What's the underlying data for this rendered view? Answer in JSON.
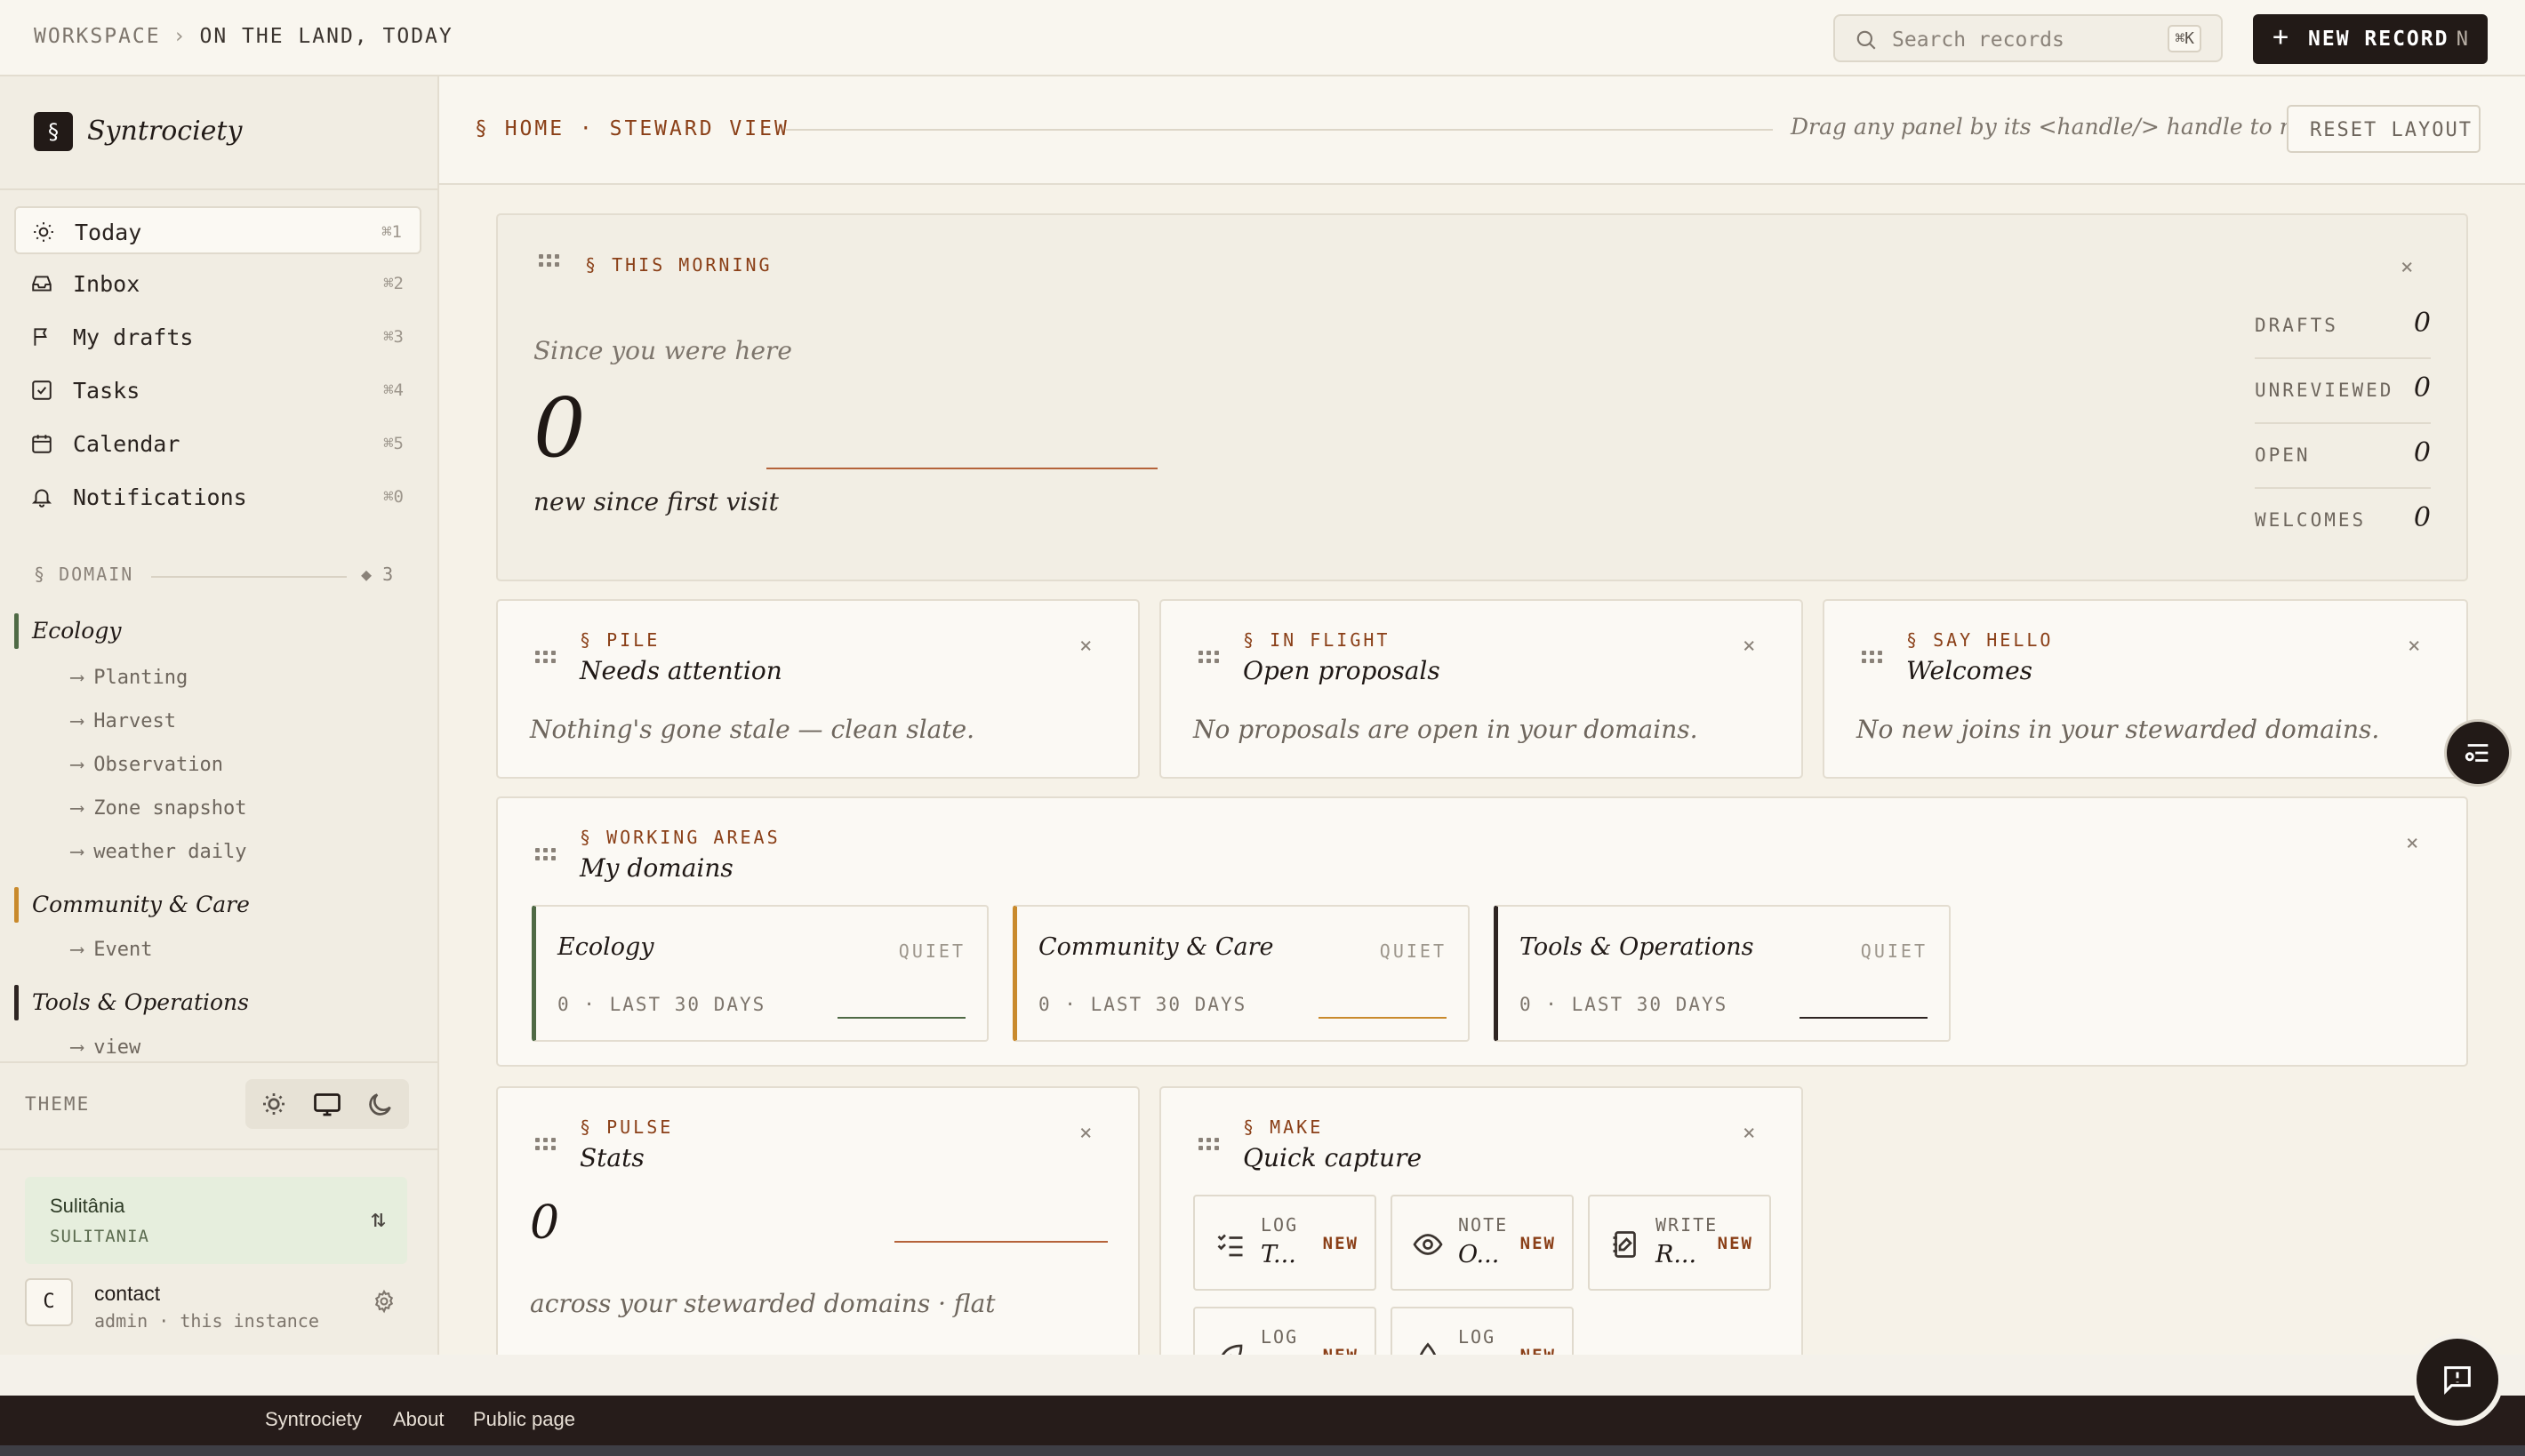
{
  "topbar": {
    "breadcrumb": [
      "WORKSPACE",
      "ON THE LAND, TODAY"
    ],
    "search_placeholder": "Search records",
    "search_shortcut": "⌘K",
    "new_record_label": "NEW RECORD",
    "new_record_key": "N"
  },
  "sidebar": {
    "brand": "Syntrociety",
    "brand_glyph": "§",
    "nav": [
      {
        "label": "Today",
        "shortcut": "⌘1",
        "icon": "sun-icon"
      },
      {
        "label": "Inbox",
        "shortcut": "⌘2",
        "icon": "inbox-icon"
      },
      {
        "label": "My drafts",
        "shortcut": "⌘3",
        "icon": "flag-icon"
      },
      {
        "label": "Tasks",
        "shortcut": "⌘4",
        "icon": "checkbox-icon"
      },
      {
        "label": "Calendar",
        "shortcut": "⌘5",
        "icon": "calendar-icon"
      },
      {
        "label": "Notifications",
        "shortcut": "⌘0",
        "icon": "bell-icon"
      }
    ],
    "domain_heading": "§ DOMAIN",
    "domain_count": "◆ 3",
    "domains": [
      {
        "name": "Ecology",
        "color": "#4f6a45",
        "items": [
          "Planting",
          "Harvest",
          "Observation",
          "Zone snapshot",
          "weather daily"
        ]
      },
      {
        "name": "Community & Care",
        "color": "#c98a2c",
        "items": [
          "Event"
        ]
      },
      {
        "name": "Tools & Operations",
        "color": "#2e2522",
        "items": [
          "view"
        ]
      }
    ],
    "theme_label": "THEME",
    "instance": {
      "name": "Sulitânia",
      "slug": "SULITANIA"
    },
    "user": {
      "initial": "C",
      "name": "contact",
      "role": "admin · this instance"
    }
  },
  "main": {
    "title": "§ HOME · STEWARD VIEW",
    "hint": "Drag any panel by its <handle/> handle to rearrange.",
    "reset_label": "RESET LAYOUT",
    "morning": {
      "tag": "§ THIS MORNING",
      "caption": "Since you were here",
      "count": "0",
      "subcaption": "new since first visit",
      "metrics": [
        {
          "label": "DRAFTS",
          "value": "0"
        },
        {
          "label": "UNREVIEWED",
          "value": "0"
        },
        {
          "label": "OPEN",
          "value": "0"
        },
        {
          "label": "WELCOMES",
          "value": "0"
        }
      ]
    },
    "pile": {
      "tag": "§ PILE",
      "title": "Needs attention",
      "body": "Nothing's gone stale — clean slate."
    },
    "flight": {
      "tag": "§ IN FLIGHT",
      "title": "Open proposals",
      "body": "No proposals are open in your domains."
    },
    "hello": {
      "tag": "§ SAY HELLO",
      "title": "Welcomes",
      "body": "No new joins in your stewarded domains."
    },
    "areas": {
      "tag": "§ WORKING AREAS",
      "title": "My domains",
      "cards": [
        {
          "name": "Ecology",
          "status": "QUIET",
          "stat": "0 · LAST 30 DAYS",
          "color": "#4f6a45"
        },
        {
          "name": "Community & Care",
          "status": "QUIET",
          "stat": "0 · LAST 30 DAYS",
          "color": "#c98a2c"
        },
        {
          "name": "Tools & Operations",
          "status": "QUIET",
          "stat": "0 · LAST 30 DAYS",
          "color": "#2e2522"
        }
      ]
    },
    "pulse": {
      "tag": "§ PULSE",
      "title": "Stats",
      "count": "0",
      "body": "across your stewarded domains · flat"
    },
    "make": {
      "tag": "§ MAKE",
      "title": "Quick capture",
      "items": [
        {
          "verb": "LOG",
          "target": "T...",
          "badge": "NEW",
          "icon": "checklist-icon"
        },
        {
          "verb": "NOTE",
          "target": "O...",
          "badge": "NEW",
          "icon": "eye-icon"
        },
        {
          "verb": "WRITE",
          "target": "R...",
          "badge": "NEW",
          "icon": "notebook-icon"
        },
        {
          "verb": "LOG",
          "target": "",
          "badge": "NEW",
          "icon": "leaf-icon"
        },
        {
          "verb": "LOG",
          "target": "",
          "badge": "NEW",
          "icon": "drop-icon"
        }
      ]
    }
  },
  "footer": {
    "links": [
      "Syntrociety",
      "About",
      "Public page"
    ]
  }
}
